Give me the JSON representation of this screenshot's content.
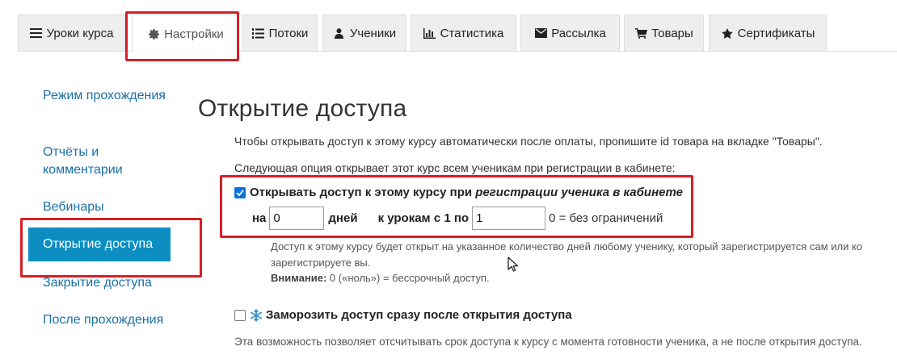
{
  "tabs": [
    {
      "label": "Уроки курса",
      "icon": "list-icon"
    },
    {
      "label": "Настройки",
      "icon": "gear-icon",
      "active": true
    },
    {
      "label": "Потоки",
      "icon": "numbered-list-icon"
    },
    {
      "label": "Ученики",
      "icon": "user-icon"
    },
    {
      "label": "Статистика",
      "icon": "bar-chart-icon"
    },
    {
      "label": "Рассылка",
      "icon": "envelope-icon"
    },
    {
      "label": "Товары",
      "icon": "cart-icon"
    },
    {
      "label": "Сертификаты",
      "icon": "star-icon"
    }
  ],
  "sidebar": {
    "items": [
      {
        "label": "Режим прохождения"
      },
      {
        "label": "Отчёты и комментарии"
      },
      {
        "label": "Вебинары"
      },
      {
        "label": "Открытие доступа",
        "active": true
      },
      {
        "label": "Закрытие доступа"
      },
      {
        "label": "После прохождения"
      }
    ]
  },
  "main": {
    "title": "Открытие доступа",
    "intro": "Чтобы открывать доступ к этому курсу автоматически после оплаты, пропишите id товара на вкладке \"Товары\".",
    "option_intro": "Следующая опция открывает этот курс всем ученикам при регистрации в кабинете:",
    "open_on_registration": {
      "checked": true,
      "label_prefix": "Открывать доступ к этому курсу при ",
      "label_italic": "регистрации ученика в кабинете",
      "for_label": "на",
      "days_value": "0",
      "days_label": "дней",
      "lessons_label": "к урокам с 1 по",
      "lessons_value": "1",
      "lessons_hint": "0 = без ограничений"
    },
    "help_line1": "Доступ к этому курсу будет открыт на указанное количество дней любому ученику, который зарегистрируется сам или ко",
    "help_line2": "зарегистрируете вы.",
    "warning_label": "Внимание:",
    "warning_text": " 0 («ноль») = бессрочный доступ.",
    "freeze": {
      "checked": false,
      "label": "Заморозить доступ сразу после открытия доступа",
      "description": "Эта возможность позволяет отсчитывать срок доступа к курсу с момента готовности ученика, а не после открытия доступа."
    }
  },
  "colors": {
    "accent": "#0c8ec2",
    "link": "#1a6fa8",
    "highlight": "#d61f26",
    "checkbox": "#0a74d9"
  }
}
